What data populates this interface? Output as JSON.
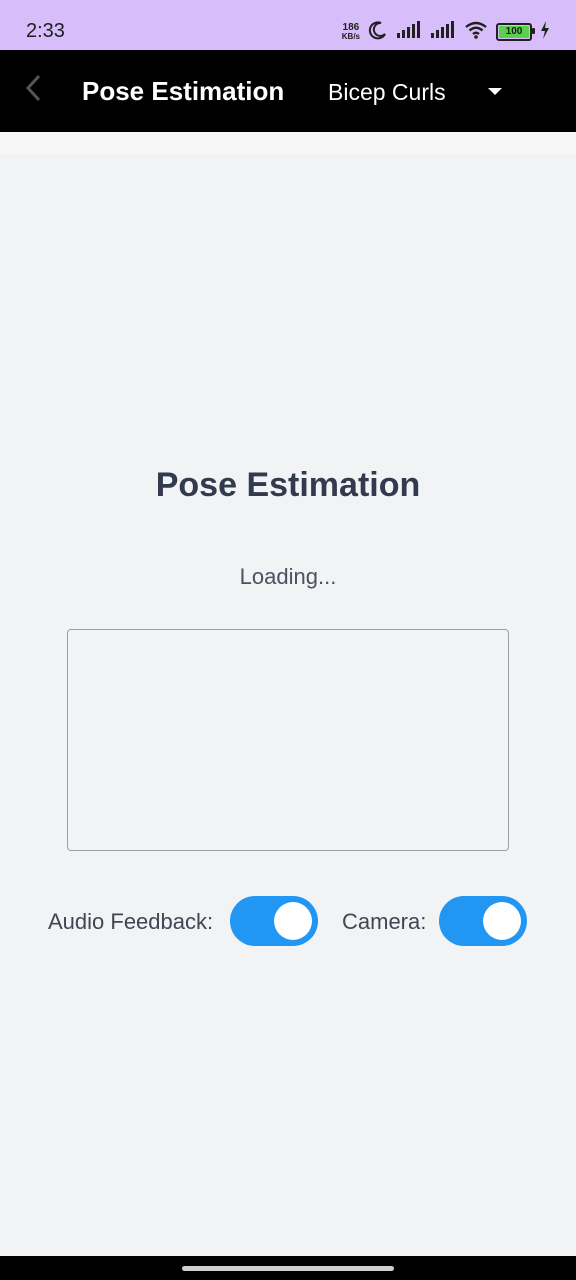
{
  "status_bar": {
    "time": "2:33",
    "net_speed_value": "186",
    "net_speed_unit": "KB/s",
    "battery_level": "100"
  },
  "app_bar": {
    "title": "Pose Estimation",
    "exercise_selected": "Bicep Curls"
  },
  "main": {
    "heading": "Pose Estimation",
    "status_text": "Loading...",
    "controls": {
      "audio_label": "Audio Feedback:",
      "audio_on": true,
      "camera_label": "Camera:",
      "camera_on": true
    }
  },
  "colors": {
    "app_bar_bg": "#000000",
    "status_bar_bg": "#d7bdf9",
    "toggle_on": "#2196f3",
    "background": "#f1f3f5"
  },
  "icons": {
    "back": "chevron-left-icon",
    "dropdown": "caret-down-icon"
  }
}
